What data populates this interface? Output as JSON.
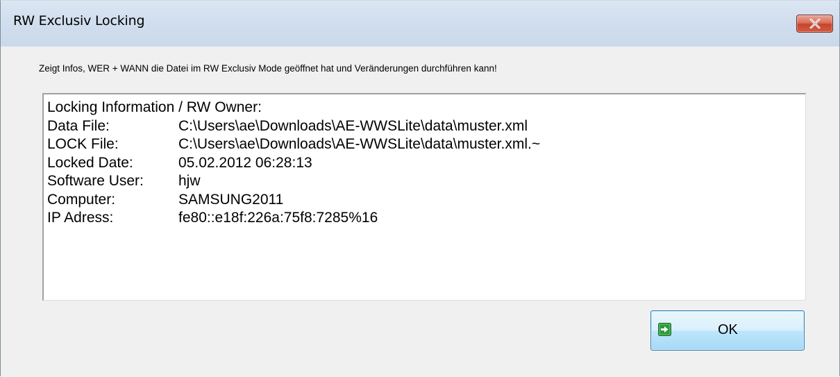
{
  "window": {
    "title": "RW Exclusiv Locking",
    "close_icon": "close-icon"
  },
  "description": "Zeigt Infos, WER + WANN die Datei im RW Exclusiv Mode geöffnet hat und Veränderungen durchführen kann!",
  "info": {
    "heading": "Locking Information / RW Owner:",
    "rows": [
      {
        "label": "Data File:",
        "value": "C:\\Users\\ae\\Downloads\\AE-WWSLite\\data\\muster.xml"
      },
      {
        "label": "LOCK File:",
        "value": "C:\\Users\\ae\\Downloads\\AE-WWSLite\\data\\muster.xml.~"
      },
      {
        "label": "Locked Date:",
        "value": "05.02.2012 06:28:13"
      },
      {
        "label": "Software User:",
        "value": "hjw"
      },
      {
        "label": "Computer:",
        "value": "SAMSUNG2011"
      },
      {
        "label": "IP Adress:",
        "value": "fe80::e18f:226a:75f8:7285%16"
      }
    ]
  },
  "ok_button": {
    "label": "OK",
    "icon": "green-arrow-icon"
  },
  "colors": {
    "close_button": "#d45a3f",
    "ok_button_border": "#3c7fb1",
    "ok_icon_green": "#2e9b3a"
  }
}
